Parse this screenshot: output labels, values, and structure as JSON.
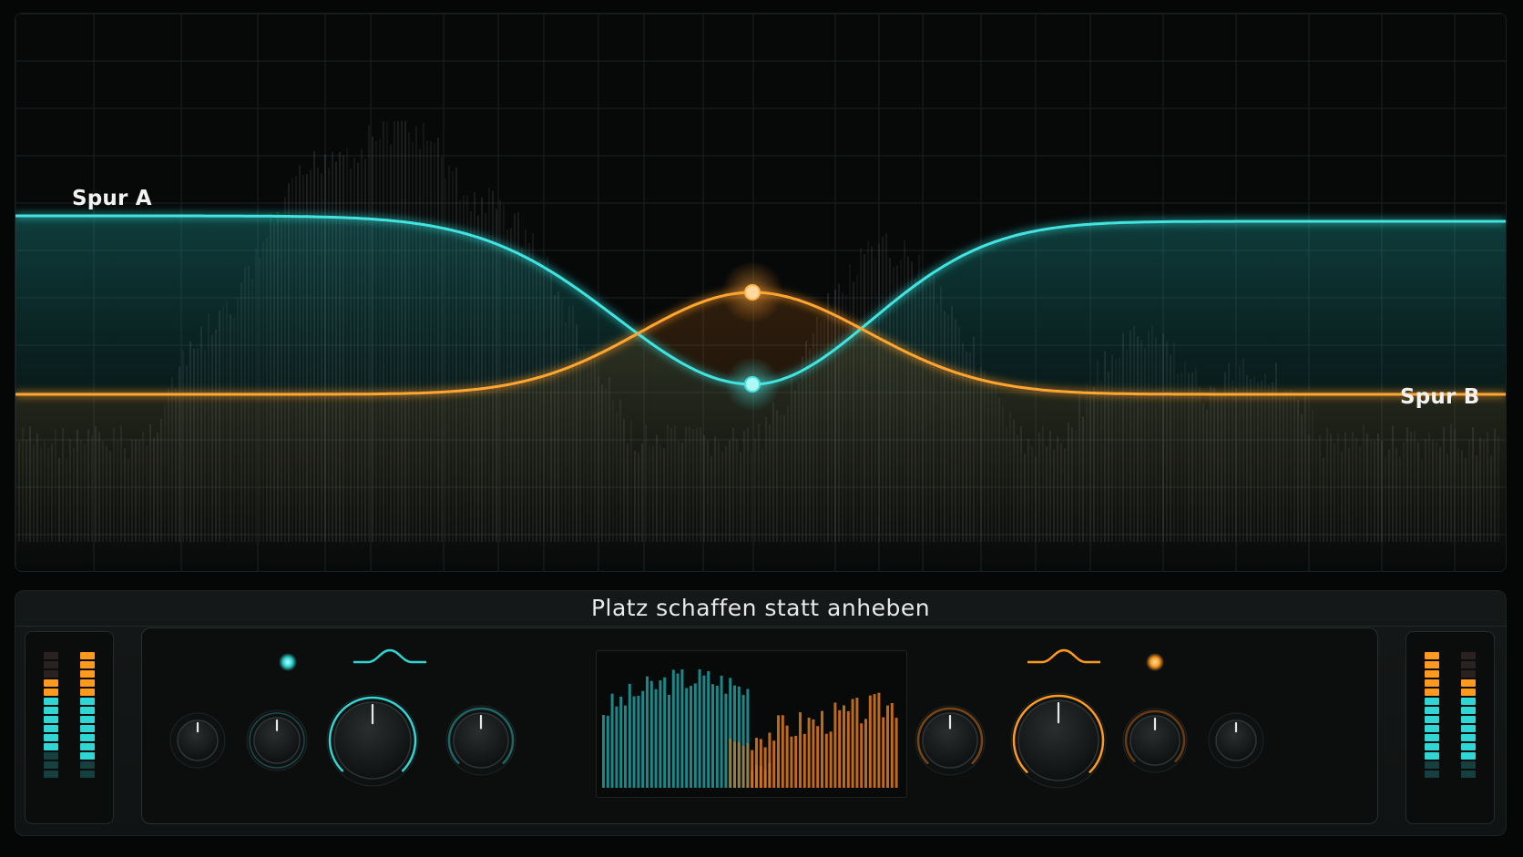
{
  "eq_display": {
    "curves": [
      {
        "name": "Spur A",
        "color": "#2fd6d3"
      },
      {
        "name": "Spur B",
        "color": "#ff9a1f"
      }
    ]
  },
  "control_section": {
    "title": "Platz schaffen statt anheben"
  },
  "track_a": {
    "color": "#2fd6d3",
    "status_led": "on",
    "filter_shape_icon": "bell-curve-icon",
    "knobs": [
      "small-knob",
      "small-knob",
      "large-knob",
      "medium-knob"
    ]
  },
  "track_b": {
    "color": "#ff9a1f",
    "status_led": "on",
    "filter_shape_icon": "bell-curve-icon",
    "knobs": [
      "medium-knob",
      "large-knob",
      "medium-knob",
      "small-knob"
    ]
  },
  "meters": {
    "left": {
      "colors": [
        "#ff8a1c",
        "#2fd6d3"
      ]
    },
    "right": {
      "colors": [
        "#ff8a1c",
        "#2fd6d3"
      ]
    }
  },
  "colors": {
    "background": "#050606",
    "accent_cyan": "#2fd6d3",
    "accent_orange": "#ff9a1f",
    "grid": "#1b2124"
  }
}
